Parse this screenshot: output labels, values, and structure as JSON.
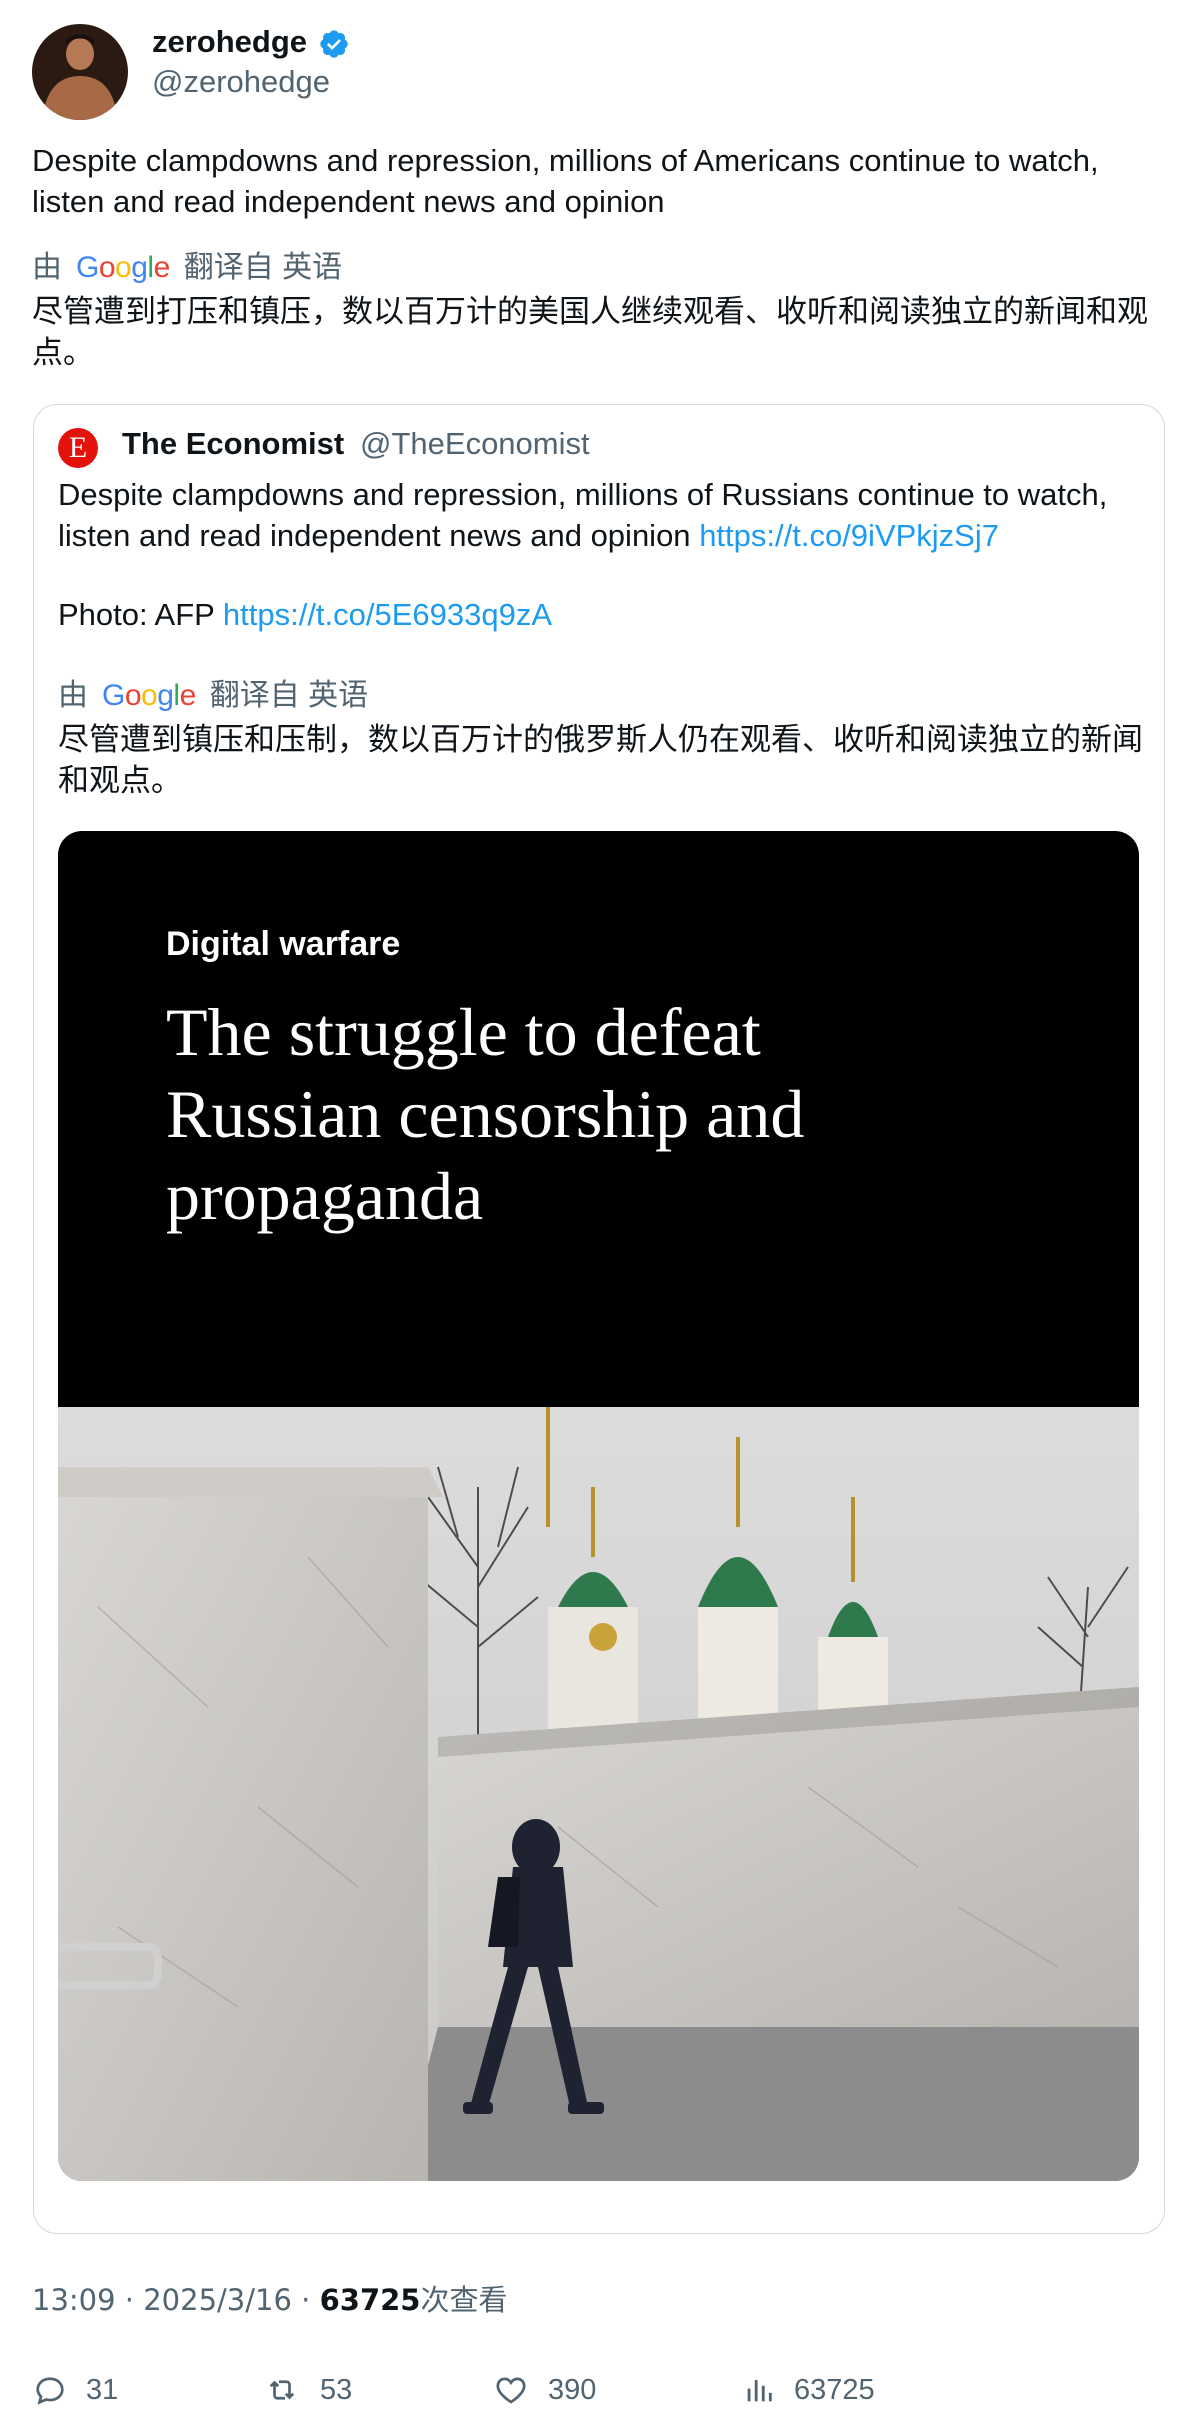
{
  "author": {
    "name": "zerohedge",
    "handle": "@zerohedge"
  },
  "tweet": {
    "text": "Despite clampdowns and repression, millions of Americans continue to watch, listen and read independent news and opinion",
    "translate": {
      "prefix": "由",
      "brand": "Google",
      "suffix": "翻译自 英语"
    },
    "translated": "尽管遭到打压和镇压，数以百万计的美国人继续观看、收听和阅读独立的新闻和观点。"
  },
  "quote": {
    "name": "The Economist",
    "handle": "@TheEconomist",
    "logo_letter": "E",
    "text": "Despite clampdowns and repression, millions of Russians continue to watch, listen and read independent news and opinion",
    "link1": "https://t.co/9iVPkjzSj7",
    "photo_label": "Photo: AFP",
    "link2": "https://t.co/5E6933q9zA",
    "translate": {
      "prefix": "由",
      "brand": "Google",
      "suffix": "翻译自 英语"
    },
    "translated": "尽管遭到镇压和压制，数以百万计的俄罗斯人仍在观看、收听和阅读独立的新闻和观点。",
    "media": {
      "kicker": "Digital warfare",
      "headline": "The struggle to defeat Russian censorship and propaganda"
    }
  },
  "meta": {
    "time_date": "13:09 · 2025/3/16 · ",
    "views": "63725",
    "views_suffix": "次查看"
  },
  "stats": {
    "replies": "31",
    "retweets": "53",
    "likes": "390",
    "views": "63725"
  },
  "colors": {
    "link": "#1d9bf0",
    "secondary_text": "#536471",
    "economist_red": "#e3120b",
    "verified": "#1d9bf0"
  }
}
